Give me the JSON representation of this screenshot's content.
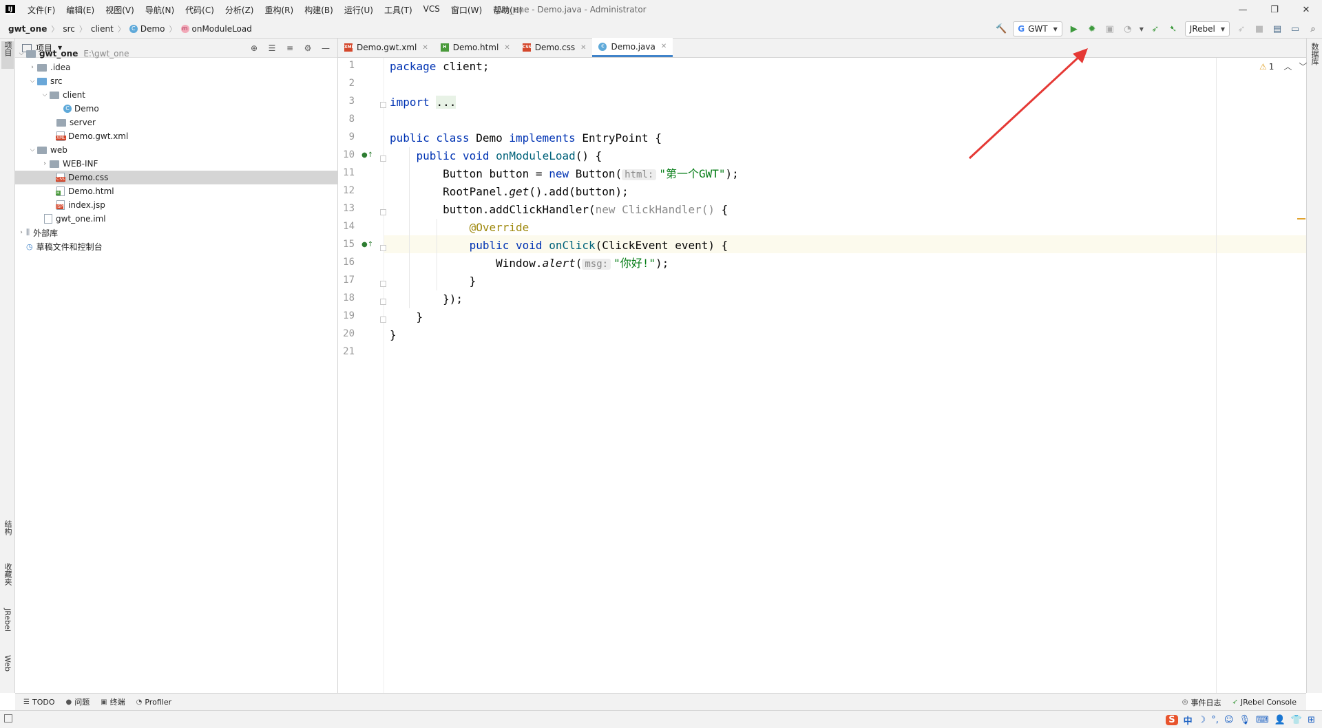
{
  "window": {
    "title": "gwt_one - Demo.java - Administrator",
    "logo": "IJ",
    "controls": [
      "—",
      "❐",
      "✕"
    ]
  },
  "menu": [
    "文件(F)",
    "编辑(E)",
    "视图(V)",
    "导航(N)",
    "代码(C)",
    "分析(Z)",
    "重构(R)",
    "构建(B)",
    "运行(U)",
    "工具(T)",
    "VCS",
    "窗口(W)",
    "帮助(H)"
  ],
  "breadcrumb": {
    "project": "gwt_one",
    "src": "src",
    "client": "client",
    "cls": "Demo",
    "method": "onModuleLoad",
    "class_icon": "C",
    "method_icon": "m"
  },
  "toolbar": {
    "run_config": "GWT",
    "run_config_icon": "G",
    "jrebel": "JRebel"
  },
  "left_strip": {
    "project_tab": "项目",
    "structure_tab": "结构",
    "favorites_tab": "收藏夹",
    "jrebel_tab": "JRebel",
    "web_tab": "Web"
  },
  "right_strip": {
    "database_tab": "数据库"
  },
  "project_panel": {
    "title": "项目",
    "tree": [
      {
        "label": "gwt_one",
        "path": "E:\\gwt_one"
      },
      {
        "label": ".idea"
      },
      {
        "label": "src"
      },
      {
        "label": "client"
      },
      {
        "label": "Demo"
      },
      {
        "label": "server"
      },
      {
        "label": "Demo.gwt.xml"
      },
      {
        "label": "web"
      },
      {
        "label": "WEB-INF"
      },
      {
        "label": "Demo.css"
      },
      {
        "label": "Demo.html"
      },
      {
        "label": "index.jsp"
      },
      {
        "label": "gwt_one.iml"
      },
      {
        "label": "外部库"
      },
      {
        "label": "草稿文件和控制台"
      }
    ]
  },
  "tabs": [
    {
      "label": "Demo.gwt.xml",
      "icon": "XML"
    },
    {
      "label": "Demo.html",
      "icon": "H"
    },
    {
      "label": "Demo.css",
      "icon": "CSS"
    },
    {
      "label": "Demo.java",
      "icon": "C"
    }
  ],
  "editor": {
    "line_numbers": [
      "1",
      "2",
      "3",
      "8",
      "9",
      "10",
      "11",
      "12",
      "13",
      "14",
      "15",
      "16",
      "17",
      "18",
      "19",
      "20",
      "21"
    ],
    "code": {
      "l1_kw": "package",
      "l1_rest": " client;",
      "l3_kw": "import",
      "l3_fold": "...",
      "l9_kw1": "public class",
      "l9_mid": " Demo ",
      "l9_kw2": "implements",
      "l9_rest": " EntryPoint {",
      "l10_kw": "public void",
      "l10_fn": "onModuleLoad",
      "l10_rest": "() {",
      "l11_a": "Button button = ",
      "l11_kw": "new",
      "l11_b": " Button(",
      "l11_hint": "html:",
      "l11_str": "\"第一个GWT\"",
      "l11_end": ");",
      "l12_a": "RootPanel.",
      "l12_it": "get",
      "l12_b": "().add(button);",
      "l13_a": "button.addClickHandler(",
      "l13_gray": "new ClickHandler()",
      "l13_b": " {",
      "l14_ann": "@Override",
      "l15_kw": "public void",
      "l15_fn": "onClick",
      "l15_rest": "(ClickEvent event) {",
      "l16_a": "Window.",
      "l16_it": "alert",
      "l16_b": "(",
      "l16_hint": "msg:",
      "l16_str": "\"你好!\"",
      "l16_end": ");",
      "l17": "}",
      "l18": "});",
      "l19": "}",
      "l20": "}"
    },
    "warning_count": "1",
    "warning_icon": "warning-triangle"
  },
  "bottom_tabs": [
    "TODO",
    "问题",
    "终端",
    "Profiler"
  ],
  "bottom_right": [
    "事件日志",
    "JRebel Console"
  ],
  "tray": [
    "中"
  ],
  "colors": {
    "keyword": "#0033b3",
    "string": "#067d17",
    "annotation": "#9e880d",
    "function": "#00627a",
    "annotation_arrow": "#e53935",
    "active_tab": "#4083c9"
  }
}
